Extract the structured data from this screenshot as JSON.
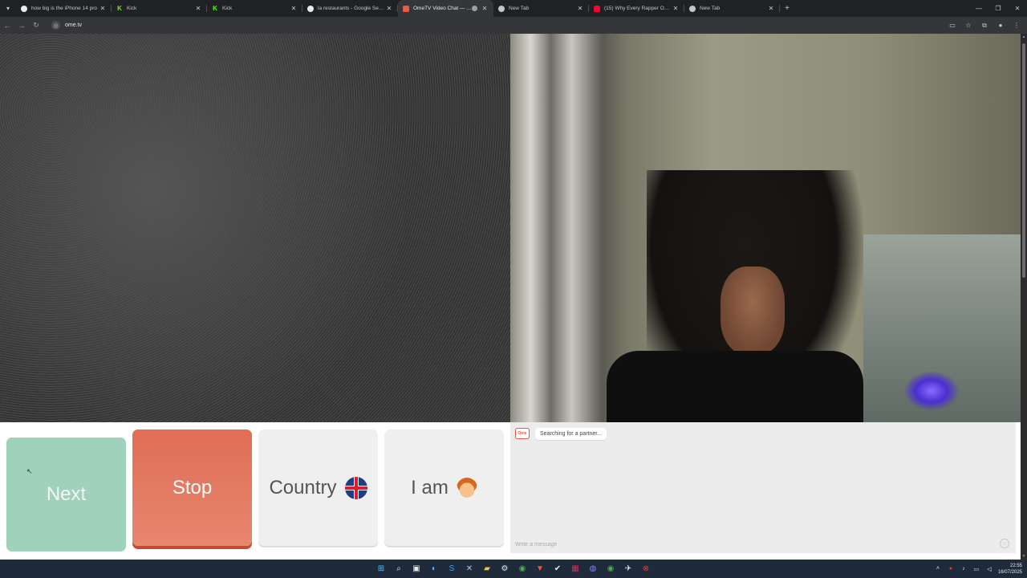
{
  "browser": {
    "tabs": [
      {
        "title": "how big is the iPhone 14 pro",
        "favicon": "google",
        "active": false
      },
      {
        "title": "Kick",
        "favicon": "kick",
        "active": false
      },
      {
        "title": "Kick",
        "favicon": "kick",
        "active": false
      },
      {
        "title": "la restaurants - Google Search",
        "favicon": "google",
        "active": false
      },
      {
        "title": "OmeTV Video Chat — Ome",
        "favicon": "ome",
        "active": true
      },
      {
        "title": "New Tab",
        "favicon": "newtab",
        "active": false
      },
      {
        "title": "(15) Why Every Rapper Owned",
        "favicon": "youtube",
        "active": false
      },
      {
        "title": "New Tab",
        "favicon": "newtab",
        "active": false
      }
    ],
    "url": "ome.tv"
  },
  "controls": {
    "next_label": "Next",
    "stop_label": "Stop",
    "country_label": "Country",
    "iam_label": "I am"
  },
  "chat": {
    "logo_text": "Ome",
    "status_message": "Searching for a partner...",
    "input_placeholder": "Write a message"
  },
  "taskbar": {
    "time": "22:55",
    "date": "16/07/2025"
  },
  "colors": {
    "next": "#9fd1bb",
    "stop": "#e07159",
    "neutral_button": "#efefef",
    "chat_bg": "#ececec"
  }
}
